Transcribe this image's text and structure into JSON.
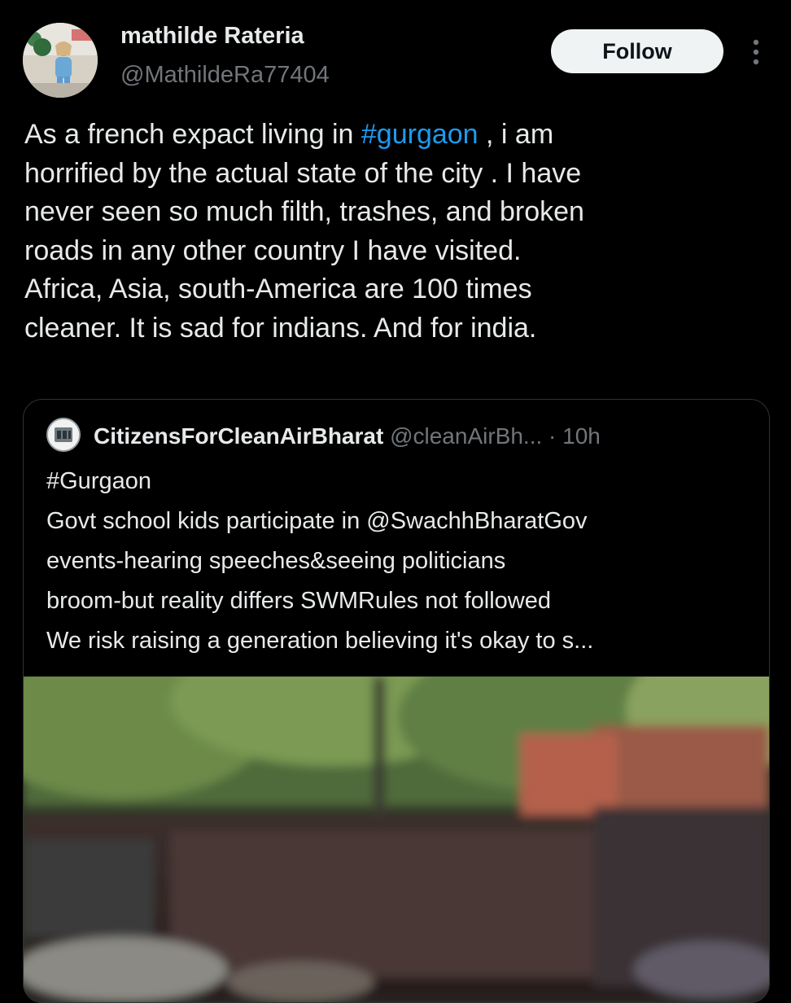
{
  "author": {
    "display_name": "mathilde Rateria",
    "handle": "@MathildeRa77404",
    "avatar_icon": "profile-photo"
  },
  "follow_button_label": "Follow",
  "more_icon": "ellipsis-vertical-icon",
  "tweet": {
    "line_1_before": "As a french expact living in ",
    "hashtag": "#gurgaon",
    "line_1_after": " , i am",
    "line_2": "horrified by the actual state of the city . I have",
    "line_3": "never seen so much filth, trashes, and broken",
    "line_4": "roads in any other country I have visited.",
    "line_5": "Africa, Asia, south-America are 100 times",
    "line_6": "cleaner. It is sad for indians. And for india."
  },
  "quote": {
    "display_name": "CitizensForCleanAirBharat",
    "handle": "@cleanAirBh...",
    "time": "· 10h",
    "line_1": "#Gurgaon",
    "line_2": "Govt school kids participate in @SwachhBharatGov",
    "line_3": "events-hearing speeches&seeing politicians",
    "line_4": "broom-but reality differs SWMRules not followed",
    "line_5": "We risk raising a generation believing it's okay to s..."
  },
  "colors": {
    "background": "#000000",
    "text": "#e7e9ea",
    "secondary_text": "#71767b",
    "link": "#1d9bf0",
    "follow_button_bg": "#eff3f4",
    "border": "#2f3336"
  }
}
